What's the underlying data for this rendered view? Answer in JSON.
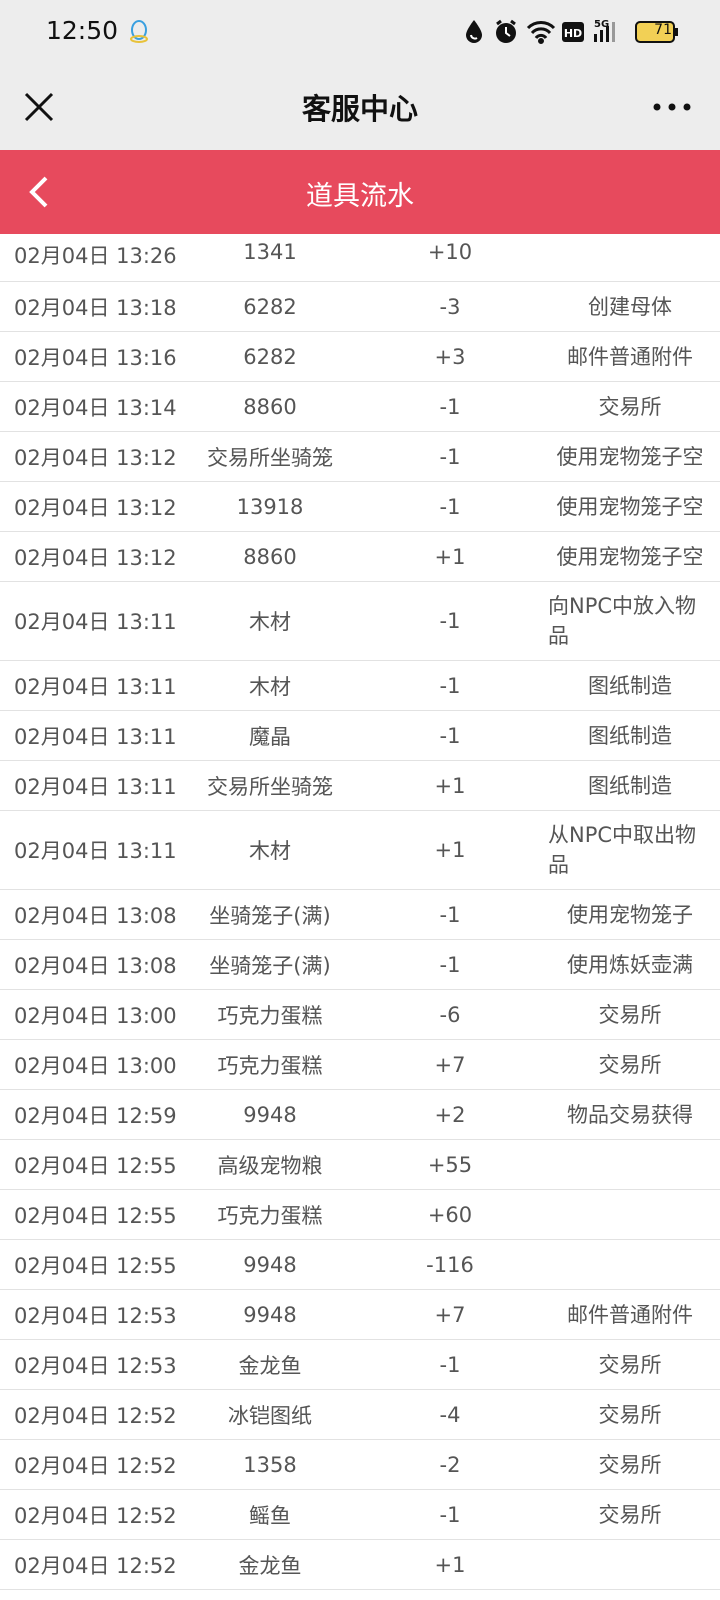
{
  "status_bar": {
    "time": "12:50",
    "battery": "71",
    "icons": [
      "qq-icon",
      "water-drop-icon",
      "alarm-icon",
      "wifi-icon",
      "hd-icon",
      "5g-signal-icon",
      "battery-icon"
    ]
  },
  "title_bar": {
    "title": "客服中心",
    "close_icon": "close-icon",
    "more_icon": "more-icon"
  },
  "header": {
    "title": "道具流水",
    "back_icon": "back-icon"
  },
  "colors": {
    "header_red": "#e74a5d",
    "titlebar_gray": "#ededed"
  },
  "rows": [
    {
      "time": "02月04日 13:26",
      "item": "1341",
      "delta": "+10",
      "source": ""
    },
    {
      "time": "02月04日 13:18",
      "item": "6282",
      "delta": "-3",
      "source": "创建母体"
    },
    {
      "time": "02月04日 13:16",
      "item": "6282",
      "delta": "+3",
      "source": "邮件普通附件"
    },
    {
      "time": "02月04日 13:14",
      "item": "8860",
      "delta": "-1",
      "source": "交易所"
    },
    {
      "time": "02月04日 13:12",
      "item": "交易所坐骑笼",
      "delta": "-1",
      "source": "使用宠物笼子空"
    },
    {
      "time": "02月04日 13:12",
      "item": "13918",
      "delta": "-1",
      "source": "使用宠物笼子空"
    },
    {
      "time": "02月04日 13:12",
      "item": "8860",
      "delta": "+1",
      "source": "使用宠物笼子空"
    },
    {
      "time": "02月04日 13:11",
      "item": "木材",
      "delta": "-1",
      "source": "向NPC中放入物品"
    },
    {
      "time": "02月04日 13:11",
      "item": "木材",
      "delta": "-1",
      "source": "图纸制造"
    },
    {
      "time": "02月04日 13:11",
      "item": "魔晶",
      "delta": "-1",
      "source": "图纸制造"
    },
    {
      "time": "02月04日 13:11",
      "item": "交易所坐骑笼",
      "delta": "+1",
      "source": "图纸制造"
    },
    {
      "time": "02月04日 13:11",
      "item": "木材",
      "delta": "+1",
      "source": "从NPC中取出物品"
    },
    {
      "time": "02月04日 13:08",
      "item": "坐骑笼子(满)",
      "delta": "-1",
      "source": "使用宠物笼子"
    },
    {
      "time": "02月04日 13:08",
      "item": "坐骑笼子(满)",
      "delta": "-1",
      "source": "使用炼妖壶满"
    },
    {
      "time": "02月04日 13:00",
      "item": "巧克力蛋糕",
      "delta": "-6",
      "source": "交易所"
    },
    {
      "time": "02月04日 13:00",
      "item": "巧克力蛋糕",
      "delta": "+7",
      "source": "交易所"
    },
    {
      "time": "02月04日 12:59",
      "item": "9948",
      "delta": "+2",
      "source": "物品交易获得"
    },
    {
      "time": "02月04日 12:55",
      "item": "高级宠物粮",
      "delta": "+55",
      "source": ""
    },
    {
      "time": "02月04日 12:55",
      "item": "巧克力蛋糕",
      "delta": "+60",
      "source": ""
    },
    {
      "time": "02月04日 12:55",
      "item": "9948",
      "delta": "-116",
      "source": ""
    },
    {
      "time": "02月04日 12:53",
      "item": "9948",
      "delta": "+7",
      "source": "邮件普通附件"
    },
    {
      "time": "02月04日 12:53",
      "item": "金龙鱼",
      "delta": "-1",
      "source": "交易所"
    },
    {
      "time": "02月04日 12:52",
      "item": "冰铠图纸",
      "delta": "-4",
      "source": "交易所"
    },
    {
      "time": "02月04日 12:52",
      "item": "1358",
      "delta": "-2",
      "source": "交易所"
    },
    {
      "time": "02月04日 12:52",
      "item": "鳐鱼",
      "delta": "-1",
      "source": "交易所"
    },
    {
      "time": "02月04日 12:52",
      "item": "金龙鱼",
      "delta": "+1",
      "source": ""
    }
  ]
}
